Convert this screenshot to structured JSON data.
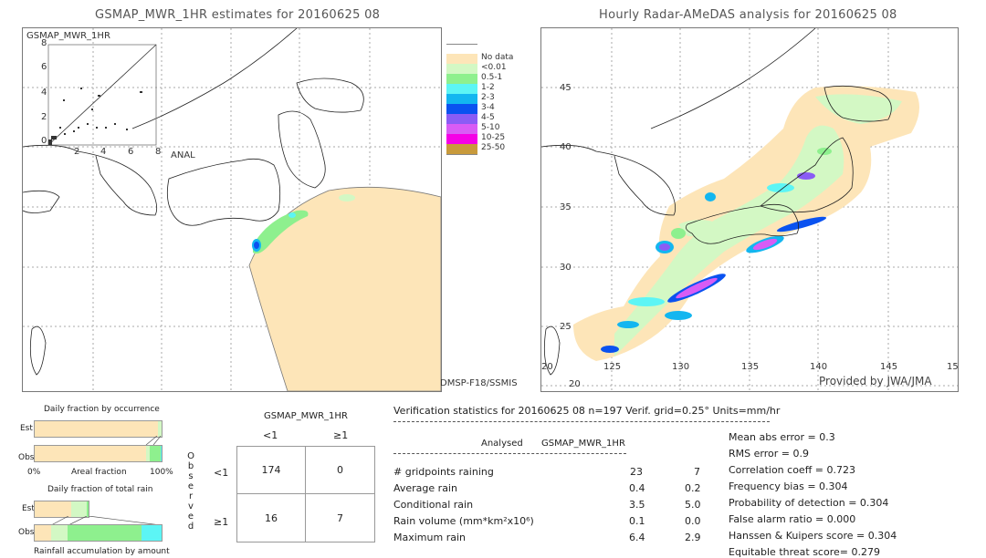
{
  "left_panel": {
    "title": "GSMAP_MWR_1HR estimates for 20160625 08",
    "scatter_label": "GSMAP_MWR_1HR",
    "scatter_y_ticks": [
      "8",
      "6",
      "4",
      "2",
      "0"
    ],
    "scatter_x_ticks": [
      "2",
      "4",
      "6",
      "8"
    ],
    "scatter_x_axis_label": "ANAL",
    "sensor_label": "DMSP-F18/SSMIS"
  },
  "right_panel": {
    "title": "Hourly Radar-AMeDAS analysis for 20160625 08",
    "lat_labels": [
      "45",
      "40",
      "35",
      "30",
      "25",
      "20"
    ],
    "lon_labels": [
      "125",
      "130",
      "135",
      "140",
      "145",
      "15"
    ],
    "corner_lon_label": "20",
    "credit": "Provided by JWA/JMA"
  },
  "legend": {
    "items": [
      {
        "label": "No data",
        "color": "#ffffff"
      },
      {
        "label": "<0.01",
        "color": "#fde5b8"
      },
      {
        "label": "0.5-1",
        "color": "#d3f8c4"
      },
      {
        "label": "1-2",
        "color": "#8ef08e"
      },
      {
        "label": "2-3",
        "color": "#5cf5f5"
      },
      {
        "label": "3-4",
        "color": "#13b6f0"
      },
      {
        "label": "4-5",
        "color": "#0a52f0"
      },
      {
        "label": "5-10",
        "color": "#8a5cf5"
      },
      {
        "label": "10-25",
        "color": "#d85cf5"
      },
      {
        "label": "25-50",
        "color": "#f500e6"
      },
      {
        "label": "",
        "color": "#c89a3c"
      }
    ]
  },
  "fraction_charts": {
    "occurrence_title": "Daily fraction by occurrence",
    "est_label": "Est",
    "obs_label": "Obs",
    "axis_left": "0%",
    "axis_center": "Areal fraction",
    "axis_right": "100%",
    "total_rain_title": "Daily fraction of total rain",
    "accumulation_label": "Rainfall accumulation by amount",
    "occurrence_est": [
      0.97,
      0.03
    ],
    "occurrence_obs": [
      0.88,
      0.03,
      0.08,
      0.01
    ],
    "total_est": [
      0.29,
      0.13,
      0.01
    ],
    "total_obs": [
      0.13,
      0.13,
      0.58,
      0.15
    ]
  },
  "contingency": {
    "model_label": "GSMAP_MWR_1HR",
    "col_headers": [
      "<1",
      "≥1"
    ],
    "row_headers": [
      "<1",
      "≥1"
    ],
    "observed_label": [
      "O",
      "b",
      "s",
      "e",
      "r",
      "v",
      "e",
      "d"
    ],
    "cells": [
      [
        "174",
        "0"
      ],
      [
        "16",
        "7"
      ]
    ]
  },
  "verification": {
    "header": "Verification statistics for 20160625 08   n=197   Verif. grid=0.25°   Units=mm/hr",
    "col_analysed": "Analysed",
    "col_model": "GSMAP_MWR_1HR",
    "rows": [
      {
        "label": "# gridpoints raining",
        "analysed": "23",
        "model": "7"
      },
      {
        "label": "Average rain",
        "analysed": "0.4",
        "model": "0.2"
      },
      {
        "label": "Conditional rain",
        "analysed": "3.5",
        "model": "5.0"
      },
      {
        "label": "Rain volume (mm*km²x10⁶)",
        "analysed": "0.1",
        "model": "0.0"
      },
      {
        "label": "Maximum rain",
        "analysed": "6.4",
        "model": "2.9"
      }
    ],
    "scores": [
      "Mean abs error = 0.3",
      "RMS error = 0.9",
      "Correlation coeff = 0.723",
      "Frequency bias = 0.304",
      "Probability of detection = 0.304",
      "False alarm ratio = 0.000",
      "Hanssen & Kuipers score = 0.304",
      "Equitable threat score= 0.279"
    ]
  }
}
